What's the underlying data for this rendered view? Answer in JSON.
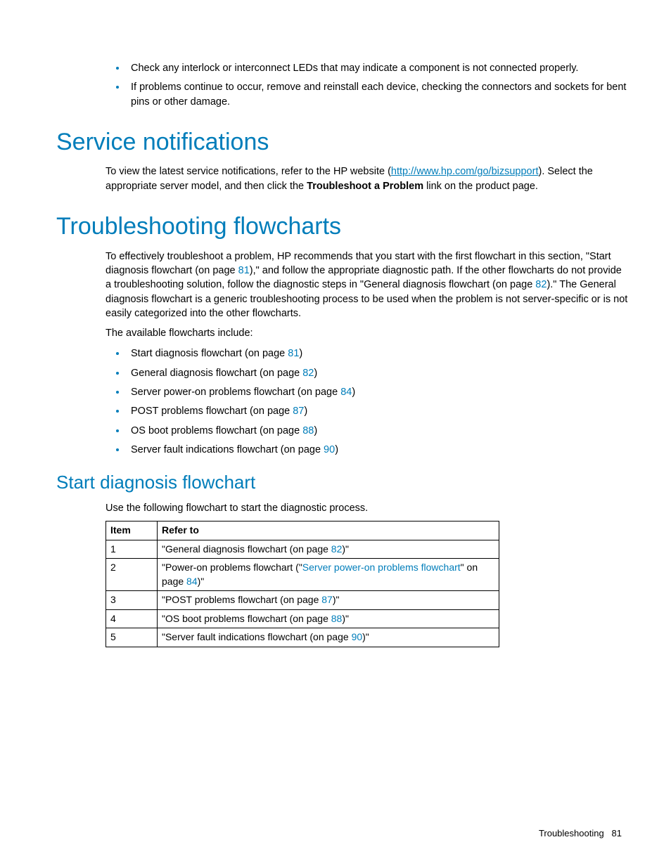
{
  "intro_bullets": [
    "Check any interlock or interconnect LEDs that may indicate a component is not connected properly.",
    "If problems continue to occur, remove and reinstall each device, checking the connectors and sockets for bent pins or other damage."
  ],
  "service": {
    "heading": "Service notifications",
    "p1a": "To view the latest service notifications, refer to the HP website (",
    "link": "http://www.hp.com/go/bizsupport",
    "p1b": "). Select the appropriate server model, and then click the ",
    "bold": "Troubleshoot a Problem",
    "p1c": " link on the product page."
  },
  "flow": {
    "heading": "Troubleshooting flowcharts",
    "p1a": "To effectively troubleshoot a problem, HP recommends that you start with the first flowchart in this section, \"Start diagnosis flowchart (on page ",
    "p1_page1": "81",
    "p1b": "),\" and follow the appropriate diagnostic path. If the other flowcharts do not provide a troubleshooting solution, follow the diagnostic steps in \"General diagnosis flowchart (on page ",
    "p1_page2": "82",
    "p1c": ").\" The General diagnosis flowchart is a generic troubleshooting process to be used when the problem is not server-specific or is not easily categorized into the other flowcharts.",
    "p2": "The available flowcharts include:",
    "list": [
      {
        "text_a": "Start diagnosis flowchart (on page ",
        "page": "81",
        "text_b": ")"
      },
      {
        "text_a": "General diagnosis flowchart (on page ",
        "page": "82",
        "text_b": ")"
      },
      {
        "text_a": "Server power-on problems flowchart (on page ",
        "page": "84",
        "text_b": ")"
      },
      {
        "text_a": "POST problems flowchart (on page ",
        "page": "87",
        "text_b": ")"
      },
      {
        "text_a": "OS boot problems flowchart (on page ",
        "page": "88",
        "text_b": ")"
      },
      {
        "text_a": "Server fault indications flowchart (on page ",
        "page": "90",
        "text_b": ")"
      }
    ]
  },
  "start": {
    "heading": "Start diagnosis flowchart",
    "p1": "Use the following flowchart to start the diagnostic process.",
    "th1": "Item",
    "th2": "Refer to",
    "rows": [
      {
        "item": "1",
        "a": "\"General diagnosis flowchart (on page ",
        "page": "82",
        "b": ")\"",
        "link": ""
      },
      {
        "item": "2",
        "a": "\"Power-on problems flowchart (\"",
        "link": "Server power-on problems flowchart",
        "mid": "\" on page ",
        "page": "84",
        "b": ")\""
      },
      {
        "item": "3",
        "a": "\"POST problems flowchart (on page ",
        "page": "87",
        "b": ")\"",
        "link": ""
      },
      {
        "item": "4",
        "a": "\"OS boot problems flowchart (on page ",
        "page": "88",
        "b": ")\"",
        "link": ""
      },
      {
        "item": "5",
        "a": "\"Server fault indications flowchart (on page ",
        "page": "90",
        "b": ")\"",
        "link": ""
      }
    ]
  },
  "footer": {
    "section": "Troubleshooting",
    "page": "81"
  }
}
